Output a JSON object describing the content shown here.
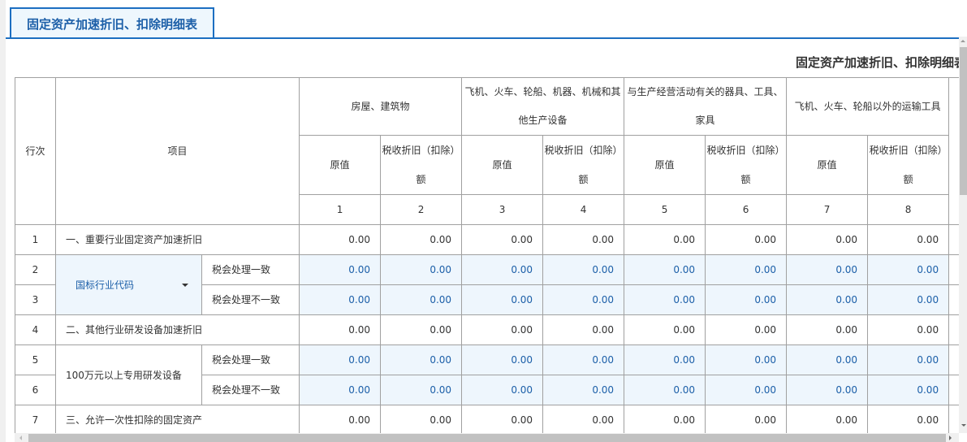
{
  "tab": {
    "label": "固定资产加速折旧、扣除明细表"
  },
  "table_title": "固定资产加速折旧、扣除明细表",
  "headers": {
    "row_no": "行次",
    "item": "项目",
    "groups": [
      "房屋、建筑物",
      "飞机、火车、轮船、机器、机械和其他生产设备",
      "与生产经营活动有关的器具、工具、家具",
      "飞机、火车、轮船以外的运输工具"
    ],
    "original": "原值",
    "tax_dep": "税收折旧（扣除）额",
    "col_numbers": [
      "1",
      "2",
      "3",
      "4",
      "5",
      "6",
      "7",
      "8"
    ]
  },
  "rows": [
    {
      "no": "1",
      "label": "一、重要行业固定资产加速折旧",
      "values": [
        "0.00",
        "0.00",
        "0.00",
        "0.00",
        "0.00",
        "0.00",
        "0.00",
        "0.00"
      ]
    },
    {
      "no": "2",
      "group": "国标行业代码",
      "sub": "税会处理一致",
      "values": [
        "0.00",
        "0.00",
        "0.00",
        "0.00",
        "0.00",
        "0.00",
        "0.00",
        "0.00"
      ]
    },
    {
      "no": "3",
      "sub": "税会处理不一致",
      "values": [
        "0.00",
        "0.00",
        "0.00",
        "0.00",
        "0.00",
        "0.00",
        "0.00",
        "0.00"
      ]
    },
    {
      "no": "4",
      "label": "二、其他行业研发设备加速折旧",
      "values": [
        "0.00",
        "0.00",
        "0.00",
        "0.00",
        "0.00",
        "0.00",
        "0.00",
        "0.00"
      ]
    },
    {
      "no": "5",
      "group": "100万元以上专用研发设备",
      "sub": "税会处理一致",
      "values": [
        "0.00",
        "0.00",
        "0.00",
        "0.00",
        "0.00",
        "0.00",
        "0.00",
        "0.00"
      ]
    },
    {
      "no": "6",
      "sub": "税会处理不一致",
      "values": [
        "0.00",
        "0.00",
        "0.00",
        "0.00",
        "0.00",
        "0.00",
        "0.00",
        "0.00"
      ]
    },
    {
      "no": "7",
      "label": "三、允许一次性扣除的固定资产",
      "values": [
        "0.00",
        "0.00",
        "0.00",
        "0.00",
        "0.00",
        "0.00",
        "0.00",
        "0.00"
      ]
    }
  ],
  "colors": {
    "accent": "#1c6fc1",
    "editable_bg": "#eef6fd",
    "editable_text": "#1c5fa8"
  }
}
